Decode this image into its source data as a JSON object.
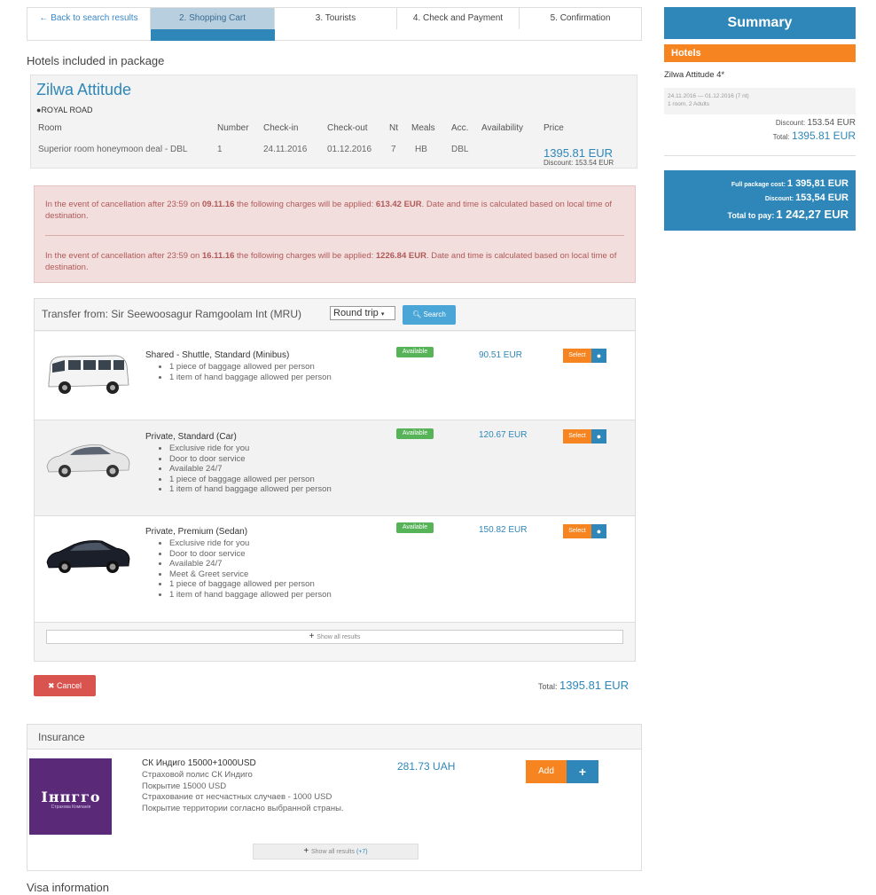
{
  "steps": [
    {
      "label": "Back to search results",
      "icon": "arrow-left-icon"
    },
    {
      "label": "2. Shopping Cart"
    },
    {
      "label": "3. Tourists"
    },
    {
      "label": "4. Check and Payment"
    },
    {
      "label": "5. Confirmation"
    }
  ],
  "hotels_heading": "Hotels included in package",
  "hotel": {
    "name": "Zilwa Attitude",
    "address": "ROYAL ROAD",
    "columns": [
      "Room",
      "Number",
      "Check-in",
      "Check-out",
      "Nt",
      "Meals",
      "Acc.",
      "Availability",
      "Price"
    ],
    "row": {
      "room": "Superior room honeymoon deal - DBL",
      "number": "1",
      "checkin": "24.11.2016",
      "checkout": "01.12.2016",
      "nights": "7",
      "meals": "HB",
      "acc": "DBL",
      "price": "1395.81 EUR",
      "discount": "Discount: 153.54 EUR"
    }
  },
  "cancellation": [
    {
      "text_before": "In the event of cancellation after 23:59 on ",
      "date": "09.11.16",
      "text_mid": " the following charges will be applied: ",
      "amount": "613.42 EUR",
      "text_after": ". Date and time is calculated based on local time of destination."
    },
    {
      "text_before": "In the event of cancellation after 23:59 on ",
      "date": "16.11.16",
      "text_mid": " the following charges will be applied: ",
      "amount": "1226.84 EUR",
      "text_after": ". Date and time is calculated based on local time of destination."
    }
  ],
  "transfer": {
    "title": "Transfer from: Sir Seewoosagur Ramgoolam Int (MRU)",
    "trip_type": "Round trip",
    "search_label": "Search",
    "options": [
      {
        "name": "Shared - Shuttle, Standard (Minibus)",
        "features": [
          "1 piece of baggage allowed per person",
          "1 item of hand baggage allowed per person"
        ],
        "availability": "Available",
        "price": "90.51 EUR",
        "select_label": "Select",
        "vehicle": "minibus-image"
      },
      {
        "name": "Private, Standard (Car)",
        "features": [
          "Exclusive ride for you",
          "Door to door service",
          "Available 24/7",
          "1 piece of baggage allowed per person",
          "1 item of hand baggage allowed per person"
        ],
        "availability": "Available",
        "price": "120.67 EUR",
        "select_label": "Select",
        "vehicle": "car-image"
      },
      {
        "name": "Private, Premium (Sedan)",
        "features": [
          "Exclusive ride for you",
          "Door to door service",
          "Available 24/7",
          "Meet & Greet service",
          "1 piece of baggage allowed per person",
          "1 item of hand baggage allowed per person"
        ],
        "availability": "Available",
        "price": "150.82 EUR",
        "select_label": "Select",
        "vehicle": "sedan-image"
      }
    ],
    "show_all": "Show all results"
  },
  "cancel_label": "Cancel",
  "total_label": "Total:",
  "total_value": "1395.81 EUR",
  "insurance": {
    "title": "Insurance",
    "logo_text": "Інпгго",
    "logo_sub": "Страхова Компанія",
    "name": "СК Индиго 15000+1000USD",
    "description": [
      "Страховой полис СК Индиго",
      "Покрытие 15000 USD",
      "Страхование от несчастных случаев - 1000 USD",
      "Покрытие территории согласно выбранной страны."
    ],
    "price": "281.73 UAH",
    "add_label": "Add",
    "show_all": "Show all results",
    "show_all_count": "(+7)"
  },
  "visa_heading": "Visa information",
  "summary": {
    "title": "Summary",
    "hotels_label": "Hotels",
    "hotel_name": "Zilwa Attitude 4*",
    "dates": "24.11.2016 — 01.12.2016 (7 nt)",
    "rooms": "1 room, 2 Adults",
    "discount_label": "Discount:",
    "discount_value": "153.54 EUR",
    "total_label": "Total:",
    "total_value": "1395.81 EUR",
    "full_cost_label": "Full package cost:",
    "full_cost_value": "1 395,81 EUR",
    "box_discount_label": "Discount:",
    "box_discount_value": "153,54 EUR",
    "to_pay_label": "Total to pay:",
    "to_pay_value": "1 242,27 EUR"
  },
  "colors": {
    "primary": "#2e87b8",
    "orange": "#f68521",
    "danger": "#d9534f",
    "success": "#57b358",
    "notice_bg": "#f3dede"
  }
}
